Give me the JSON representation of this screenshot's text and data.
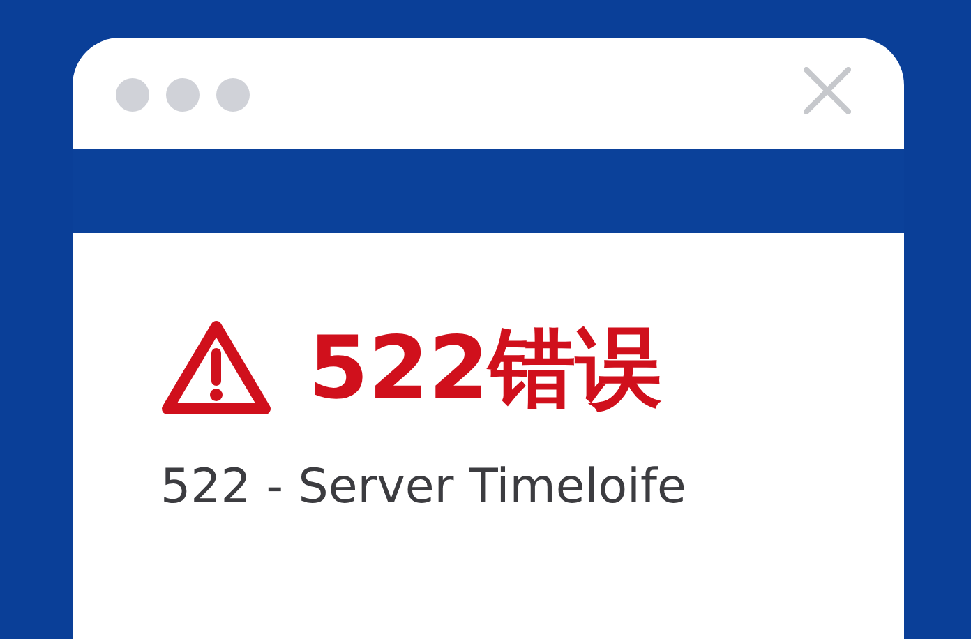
{
  "error": {
    "title": "522错误",
    "message": "522 - Server Timeloife"
  }
}
